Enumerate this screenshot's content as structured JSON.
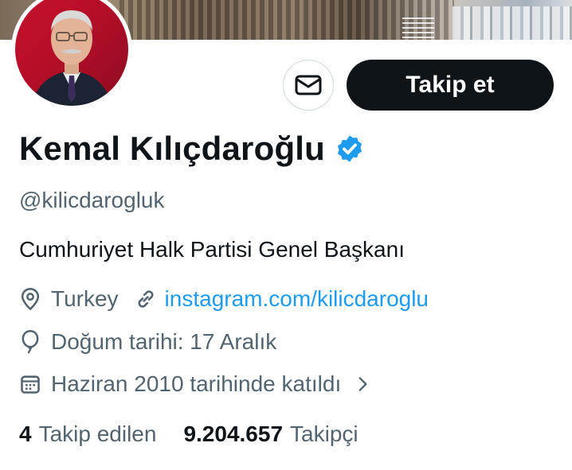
{
  "profile": {
    "name": "Kemal Kılıçdaroğlu",
    "handle": "@kilicdarogluk",
    "bio": "Cumhuriyet Halk Partisi Genel Başkanı",
    "location": "Turkey",
    "website": "instagram.com/kilicdaroglu",
    "birthday": "Doğum tarihi: 17 Aralık",
    "joined": "Haziran 2010 tarihinde katıldı"
  },
  "actions": {
    "follow_label": "Takip et"
  },
  "stats": {
    "following_count": "4",
    "following_label": "Takip edilen",
    "followers_count": "9.204.657",
    "followers_label": "Takipçi"
  },
  "icons": {
    "message": "envelope-icon",
    "verified": "verified-badge-icon",
    "location": "location-pin-icon",
    "link": "link-icon",
    "birthday": "balloon-icon",
    "joined": "calendar-icon",
    "chevron": "chevron-right-icon"
  },
  "colors": {
    "accent": "#1d9bf0",
    "text_primary": "#0f1419",
    "text_secondary": "#536471",
    "button_dark": "#0f1419"
  }
}
